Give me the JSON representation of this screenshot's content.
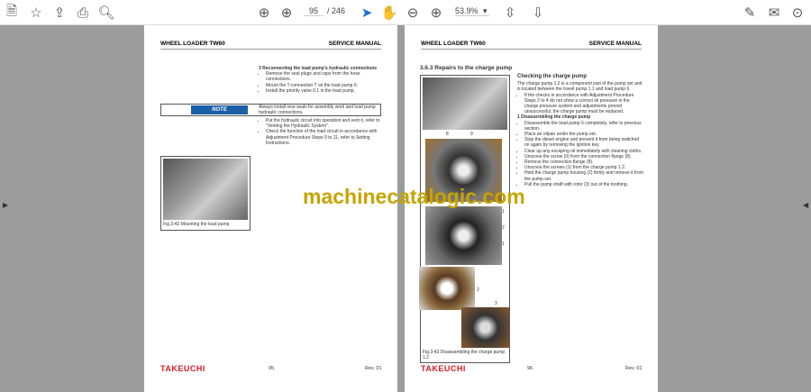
{
  "toolbar": {
    "page_current": "95",
    "page_total": "/ 246",
    "zoom": "53.9%"
  },
  "left_page": {
    "header_left": "WHEEL LOADER TW60",
    "header_right": "SERVICE MANUAL",
    "step_title": "3   Reconnecting the load pump's hydraulic connections",
    "bullets1": [
      "Remove the seal plugs and caps from the hose connections.",
      "Mount the T-connection T on the load pump 6.",
      "Install the priority valve 6.1 in the load pump."
    ],
    "note_label": "NOTE",
    "note_text": "Always install new seals for assembly work and load pump hydraulic connections.",
    "bullets2": [
      "Put the hydraulic circuit into operation and vent it, refer to \"Venting the Hydraulic System\".",
      "Check the function of the load circuit in accordance with Adjustment Procedure Steps 9 to 11, refer to Setting Instructions."
    ],
    "fig_caption": "Fig.3-42  Mounting the load pump",
    "logo": "TAKEUCHI",
    "page_number": "95",
    "rev": "Rev. 01"
  },
  "right_page": {
    "header_left": "WHEEL LOADER TW60",
    "header_right": "SERVICE MANUAL",
    "section": "3.6.3     Repairs to the charge pump",
    "subtitle": "Checking the charge pump",
    "intro": "The charge pump 1.2 is a component part of the pump set and is located between the travel pump 1.1 and load pump 6.",
    "bullets1": [
      "If the checks in accordance with Adjustment Procedure Steps 2 to 4 do not show a correct oil pressure in the charge pressure system and adjustments proved unsuccessful, the charge pump must be replaced."
    ],
    "step_title": "1   Disassembling the charge pump",
    "bullets2": [
      "Disassemble the load pump 6 completely, refer to previous section.",
      "Place an oilpan under the pump set.",
      "Stop the diesel engine and prevent it from being switched on again by removing the ignition key.",
      "Clear up any escaping oil immediately with cleaning cloths.",
      "Unscrew the screw (9) from the connection flange (8).",
      "Remove the connection flange (8).",
      "Unscrew the screws (1) from the charge pump 1.2.",
      "Hold the charge pump housing (2) firmly and remove it from the pump set.",
      "Pull the pump shaft with rotor (3) out of the toothing."
    ],
    "labels": [
      "8",
      "9",
      "1",
      "2",
      "1",
      "2",
      "3"
    ],
    "fig_caption": "Fig.3-43  Disassembling the charge pump 1.2",
    "logo": "TAKEUCHI",
    "page_number": "96",
    "rev": "Rev. 01"
  },
  "watermark": "machinecatalogic.com"
}
